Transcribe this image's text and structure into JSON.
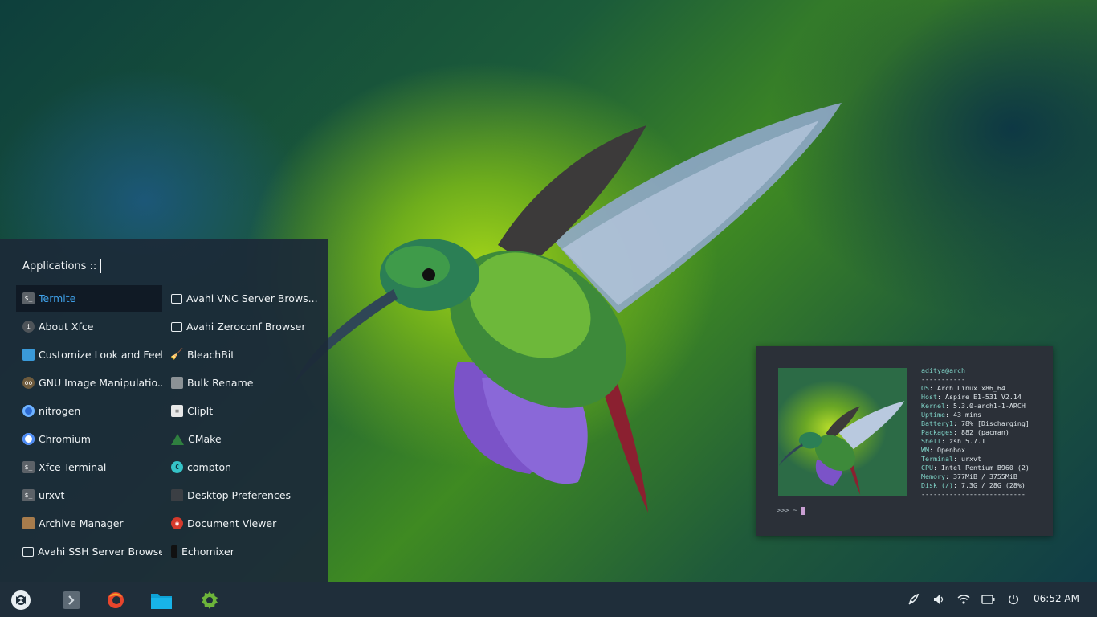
{
  "menu": {
    "title": "Applications ::",
    "left_items": [
      {
        "label": "Termite",
        "icon": "terminal-icon",
        "active": true
      },
      {
        "label": "About Xfce",
        "icon": "info-icon"
      },
      {
        "label": "Customize Look and Feel",
        "icon": "appearance-icon"
      },
      {
        "label": "GNU Image Manipulatio...",
        "icon": "gimp-icon"
      },
      {
        "label": "nitrogen",
        "icon": "nitrogen-icon"
      },
      {
        "label": "Chromium",
        "icon": "chromium-icon"
      },
      {
        "label": "Xfce Terminal",
        "icon": "terminal-icon"
      },
      {
        "label": "urxvt",
        "icon": "terminal-icon"
      },
      {
        "label": "Archive Manager",
        "icon": "archive-icon"
      },
      {
        "label": "Avahi SSH Server Browser",
        "icon": "monitor-icon"
      }
    ],
    "right_items": [
      {
        "label": "Avahi VNC Server Brows...",
        "icon": "monitor-icon"
      },
      {
        "label": "Avahi Zeroconf Browser",
        "icon": "monitor-icon"
      },
      {
        "label": "BleachBit",
        "icon": "broom-icon"
      },
      {
        "label": "Bulk Rename",
        "icon": "rename-icon"
      },
      {
        "label": "ClipIt",
        "icon": "clipboard-icon"
      },
      {
        "label": "CMake",
        "icon": "cmake-icon"
      },
      {
        "label": "compton",
        "icon": "compton-icon"
      },
      {
        "label": "Desktop Preferences",
        "icon": "desktop-icon"
      },
      {
        "label": "Document Viewer",
        "icon": "document-viewer-icon"
      },
      {
        "label": "Echomixer",
        "icon": "mixer-icon"
      }
    ]
  },
  "terminal": {
    "user_host": "aditya@arch",
    "separator": "-----------",
    "info": [
      {
        "key": "OS",
        "value": "Arch Linux x86_64"
      },
      {
        "key": "Host",
        "value": "Aspire E1-531 V2.14"
      },
      {
        "key": "Kernel",
        "value": "5.3.0-arch1-1-ARCH"
      },
      {
        "key": "Uptime",
        "value": "43 mins"
      },
      {
        "key": "Battery1",
        "value": "78% [Discharging]"
      },
      {
        "key": "Packages",
        "value": "882 (pacman)"
      },
      {
        "key": "Shell",
        "value": "zsh 5.7.1"
      },
      {
        "key": "WM",
        "value": "Openbox"
      },
      {
        "key": "Terminal",
        "value": "urxvt"
      },
      {
        "key": "CPU",
        "value": "Intel Pentium B960 (2)"
      },
      {
        "key": "Memory",
        "value": "377MiB / 3755MiB"
      },
      {
        "key": "Disk (/)",
        "value": "7.3G / 28G (28%)"
      }
    ],
    "bottom_separator": "--------------------------",
    "prompt": ">>>  ~"
  },
  "taskbar": {
    "launchers": [
      "menu-icon",
      "terminal-icon",
      "firefox-icon",
      "files-icon",
      "settings-icon"
    ],
    "tray": [
      "paint-icon",
      "volume-icon",
      "wifi-icon",
      "battery-icon",
      "power-icon"
    ],
    "clock": "06:52 AM"
  },
  "colors": {
    "accent": "#3fa0e8",
    "panel": "#1f2e3a",
    "menu": "#1c2a38",
    "terminal": "#2b3038"
  }
}
